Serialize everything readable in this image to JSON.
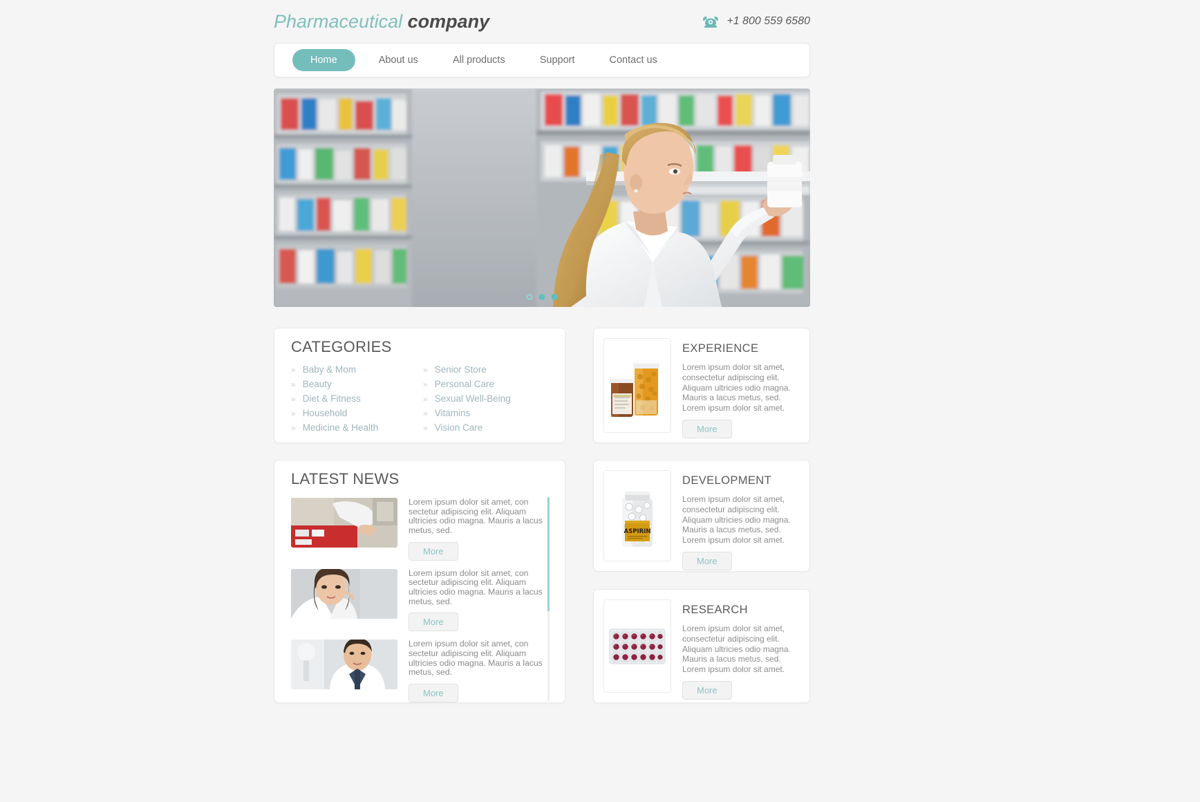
{
  "header": {
    "logo_first": "Pharmaceutical",
    "logo_second": "company",
    "phone_icon": "telephone-icon",
    "phone": "+1 800 559 6580"
  },
  "nav": {
    "items": [
      {
        "label": "Home",
        "active": true
      },
      {
        "label": "About us",
        "active": false
      },
      {
        "label": "All products",
        "active": false
      },
      {
        "label": "Support",
        "active": false
      },
      {
        "label": "Contact us",
        "active": false
      }
    ]
  },
  "hero": {
    "alt": "pharmacist-reaching-for-medicine-bottle-on-shelf",
    "dots": [
      "hollow",
      "filled",
      "filled"
    ]
  },
  "categories": {
    "title": "CATEGORIES",
    "chevron": "»",
    "left_column": [
      "Baby & Mom",
      "Beauty",
      "Diet & Fitness",
      "Household",
      "Medicine & Health"
    ],
    "right_column": [
      "Senior Store",
      "Personal Care",
      "Sexual Well-Being",
      "Vitamins",
      "Vision Care"
    ]
  },
  "news": {
    "title": "LATEST NEWS",
    "more_label": "More",
    "items": [
      {
        "thumb": "pharmacist-hands-at-red-cabinet",
        "text": "Lorem ipsum dolor sit amet, con sectetur adipiscing elit. Aliquam ultricies odio magna. Mauris a lacus metus, sed.",
        "more_label": "More"
      },
      {
        "thumb": "woman-doctor-portrait",
        "text": "Lorem ipsum dolor sit amet, con sectetur adipiscing elit. Aliquam ultricies odio magna. Mauris a lacus metus, sed.",
        "more_label": "More"
      },
      {
        "thumb": "male-doctor-in-white-coat",
        "text": "Lorem ipsum dolor sit amet, con sectetur adipiscing elit. Aliquam ultricies odio magna. Mauris a lacus metus, sed.",
        "more_label": "More"
      }
    ]
  },
  "features": [
    {
      "title": "EXPERIENCE",
      "image": "two-prescription-pill-bottles",
      "desc": "Lorem ipsum dolor sit amet, consectetur adipiscing elit. Aliquam ultricies odio magna. Mauris a lacus metus, sed. Lorem ipsum dolor sit amet.",
      "more_label": "More"
    },
    {
      "title": "DEVELOPMENT",
      "image": "aspirin-bottle",
      "image_label": "ASPIRIN",
      "desc": "Lorem ipsum dolor sit amet, consectetur adipiscing elit. Aliquam ultricies odio magna. Mauris a lacus metus, sed. Lorem ipsum dolor sit amet.",
      "more_label": "More"
    },
    {
      "title": "RESEARCH",
      "image": "blister-pack-of-pills",
      "desc": "Lorem ipsum dolor sit amet, consectetur adipiscing elit. Aliquam ultricies odio magna. Mauris a lacus metus, sed. Lorem ipsum dolor sit amet.",
      "more_label": "More"
    }
  ],
  "colors": {
    "accent_teal": "#74bdbb",
    "logo_teal": "#7fbfbd",
    "page_bg": "#f5f5f5",
    "card_bg": "#ffffff",
    "link_blue_gray": "#9fb6bd",
    "body_text": "#8a8a8a"
  }
}
